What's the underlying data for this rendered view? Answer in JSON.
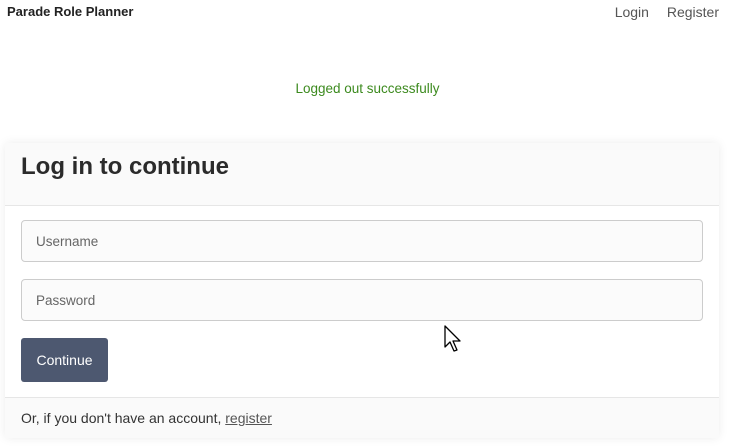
{
  "navbar": {
    "brand": "Parade Role Planner",
    "links": [
      {
        "label": "Login"
      },
      {
        "label": "Register"
      }
    ]
  },
  "flash": {
    "message": "Logged out successfully",
    "color": "#3c8a1e"
  },
  "login": {
    "title": "Log in to continue",
    "username_placeholder": "Username",
    "password_placeholder": "Password",
    "submit_label": "Continue",
    "footer_prefix": "Or, if you don't have an account,",
    "footer_link": "register"
  },
  "colors": {
    "button_bg": "#4d5870",
    "card_header_bg": "#fafafa"
  },
  "icons": {
    "pointer": "mouse-pointer-icon"
  }
}
